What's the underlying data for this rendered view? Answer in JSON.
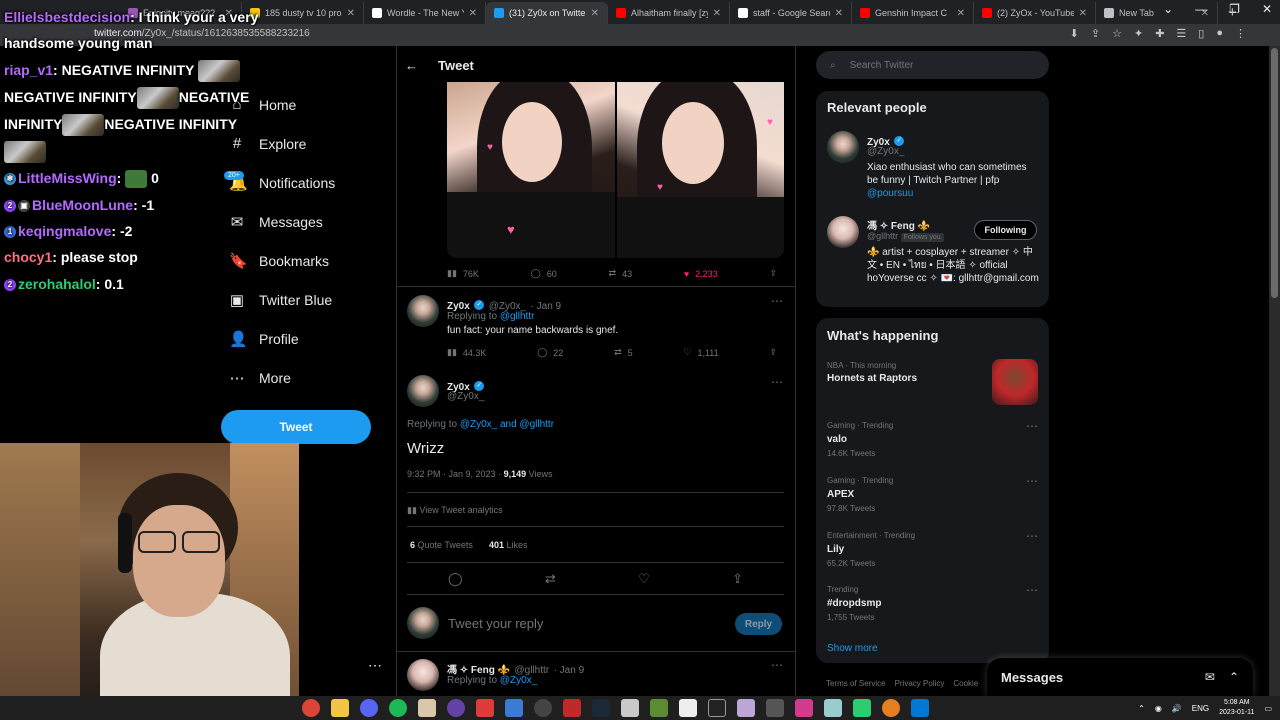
{
  "browser": {
    "tabs": [
      {
        "title": "Enigoity meaq???",
        "color": "#9b59b6"
      },
      {
        "title": "185 dusty tv 10 pro",
        "color": "#f1c40f"
      },
      {
        "title": "Wordle - The New York",
        "color": "#ffffff"
      },
      {
        "title": "(31) Zy0x on Twitter: \"",
        "color": "#1d9bf0"
      },
      {
        "title": "Alhaitham finally [zy0x",
        "color": "#ff0000"
      },
      {
        "title": "staff - Google Search",
        "color": "#ffffff"
      },
      {
        "title": "Genshin Impact C",
        "color": "#ff0000"
      },
      {
        "title": "(2) ZyOx - YouTube",
        "color": "#ff0000"
      },
      {
        "title": "New Tab",
        "color": "#bdc1c6"
      }
    ],
    "active_tab": 3,
    "url_host": "twitter.com",
    "url_path": "/Zy0x_/status/1612638535588233216",
    "window_controls": [
      "⌄",
      "—",
      "❐",
      "✕"
    ]
  },
  "chat": [
    {
      "user": "Ellielsbestdecision",
      "color": "#b36bff",
      "text": "I think your a very handsome young man"
    },
    {
      "user": "riap_v1",
      "color": "#b36bff",
      "text": "NEGATIVE INFINITY"
    },
    {
      "line2": "NEGATIVE INFINITY",
      "line2b": "NEGATIVE"
    },
    {
      "line3": "INFINITY",
      "line3b": "NEGATIVE INFINITY"
    },
    {
      "user": "LittleMissWing",
      "color": "#b36bff",
      "text": "0"
    },
    {
      "user": "BlueMoonLune",
      "color": "#b36bff",
      "text": "-1"
    },
    {
      "user": "keqingmalove",
      "color": "#b36bff",
      "text": "-2"
    },
    {
      "user": "chocy1",
      "color": "#ff6f7f",
      "text": "please stop"
    },
    {
      "user": "zerohahalol",
      "color": "#2ecc71",
      "text": "0.1"
    }
  ],
  "nav": {
    "items": [
      {
        "label": "Home",
        "icon": "⌂"
      },
      {
        "label": "Explore",
        "icon": "#"
      },
      {
        "label": "Notifications",
        "icon": "🔔"
      },
      {
        "label": "Messages",
        "icon": "✉"
      },
      {
        "label": "Bookmarks",
        "icon": "🔖"
      },
      {
        "label": "Twitter Blue",
        "icon": "▣"
      },
      {
        "label": "Profile",
        "icon": "👤"
      },
      {
        "label": "More",
        "icon": "⋯"
      }
    ],
    "notif_badge": "20+",
    "tweet_button": "Tweet",
    "more_dots": "⋯"
  },
  "header": {
    "back": "←",
    "title": "Tweet"
  },
  "image_tweet_stats": {
    "views": "76K",
    "replies": "60",
    "retweets": "43",
    "likes": "2,233"
  },
  "reply1": {
    "name": "Zy0x",
    "handle": "@Zy0x_",
    "date": "· Jan 9",
    "replying_prefix": "Replying to",
    "replying_to": "@gllhttr",
    "text": "fun fact: your name backwards is gnef.",
    "views": "44.3K",
    "replies": "22",
    "retweets": "5",
    "likes": "1,111"
  },
  "main_tweet": {
    "name": "Zy0x",
    "handle": "@Zy0x_",
    "replying_prefix": "Replying to",
    "replying_to": "@Zy0x_ and @gllhttr",
    "text": "Wrizz",
    "time": "9:32 PM · Jan 9, 2023 ·",
    "views_count": "9,149",
    "views_label": "Views",
    "analytics": "View Tweet analytics",
    "quote_count": "6",
    "quote_label": "Quote Tweets",
    "likes_count": "401",
    "likes_label": "Likes"
  },
  "reply_box": {
    "placeholder": "Tweet your reply",
    "button": "Reply"
  },
  "reply2": {
    "name": "馮 ✧ Feng ⚜️",
    "handle": "@gllhttr",
    "date": "· Jan 9",
    "replying_prefix": "Replying to",
    "replying_to": "@Zy0x_"
  },
  "search": {
    "placeholder": "Search Twitter"
  },
  "relevant_people": {
    "title": "Relevant people",
    "people": [
      {
        "name": "Zy0x",
        "handle": "@Zy0x_",
        "bio": "Xiao enthusiast who can sometimes be funny | Twitch Partner | pfp",
        "bio_link": "@poursuu"
      },
      {
        "name": "馮 ✧ Feng ⚜️",
        "handle": "@gllhttr",
        "follows_you": "Follows you",
        "bio": "⚜️ artist + cosplayer + streamer ✧ 中文 • EN • ไทย • 日本語 ✧ official hoYoverse cc ✧ 💌: gllhttr@gmail.com",
        "button": "Following"
      }
    ]
  },
  "whats_happening": {
    "title": "What's happening",
    "items": [
      {
        "meta": "NBA · This morning",
        "name": "Hornets at Raptors",
        "count": ""
      },
      {
        "meta": "Gaming · Trending",
        "name": "valo",
        "count": "14.6K Tweets"
      },
      {
        "meta": "Gaming · Trending",
        "name": "APEX",
        "count": "97.8K Tweets"
      },
      {
        "meta": "Entertainment · Trending",
        "name": "Lily",
        "count": "65.2K Tweets"
      },
      {
        "meta": "Trending",
        "name": "#dropdsmp",
        "count": "1,755 Tweets"
      }
    ],
    "show_more": "Show more"
  },
  "footer": [
    "Terms of Service",
    "Privacy Policy",
    "Cookie"
  ],
  "messages_dock": {
    "title": "Messages"
  },
  "taskbar": {
    "lang": "ENG",
    "time": "5:08 AM",
    "date": "2023-01-11"
  }
}
